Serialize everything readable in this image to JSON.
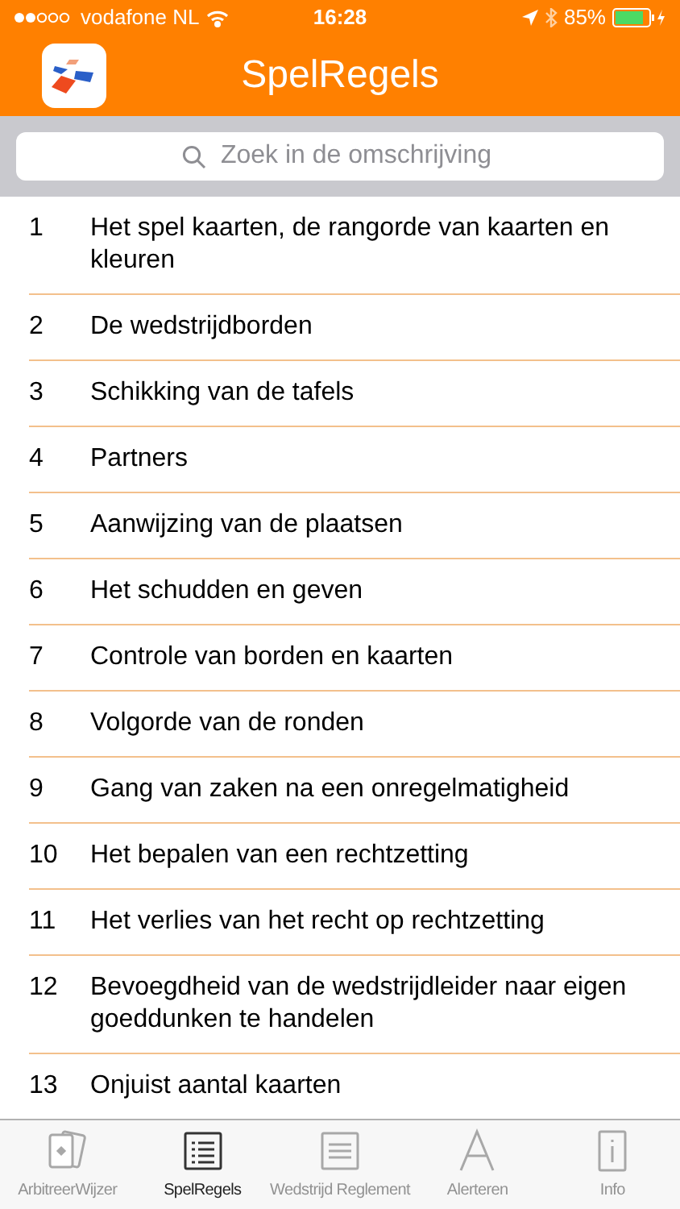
{
  "status_bar": {
    "carrier": "vodafone NL",
    "time": "16:28",
    "battery": "85%"
  },
  "header": {
    "title": "SpelRegels"
  },
  "search": {
    "placeholder": "Zoek in de omschrijving"
  },
  "rules": [
    {
      "number": "1",
      "title": "Het spel kaarten, de rangorde van kaarten en kleuren"
    },
    {
      "number": "2",
      "title": "De wedstrijdborden"
    },
    {
      "number": "3",
      "title": "Schikking van de tafels"
    },
    {
      "number": "4",
      "title": "Partners"
    },
    {
      "number": "5",
      "title": "Aanwijzing van de plaatsen"
    },
    {
      "number": "6",
      "title": "Het schudden en geven"
    },
    {
      "number": "7",
      "title": "Controle van borden en kaarten"
    },
    {
      "number": "8",
      "title": "Volgorde van de ronden"
    },
    {
      "number": "9",
      "title": "Gang van zaken na een onregelmatigheid"
    },
    {
      "number": "10",
      "title": "Het bepalen van een rechtzetting"
    },
    {
      "number": "11",
      "title": "Het verlies van het recht op rechtzetting"
    },
    {
      "number": "12",
      "title": "Bevoegdheid van de wedstrijdleider naar eigen goeddunken te handelen"
    },
    {
      "number": "13",
      "title": "Onjuist aantal kaarten"
    }
  ],
  "tab_bar": [
    {
      "kind": "cards",
      "label": "ArbitreerWijzer",
      "selected": false
    },
    {
      "kind": "list",
      "label": "SpelRegels",
      "selected": true
    },
    {
      "kind": "lines",
      "label": "Wedstrijd Reglement",
      "selected": false
    },
    {
      "kind": "letter",
      "label": "Alerteren",
      "selected": false
    },
    {
      "kind": "info",
      "label": "Info",
      "selected": false
    }
  ]
}
